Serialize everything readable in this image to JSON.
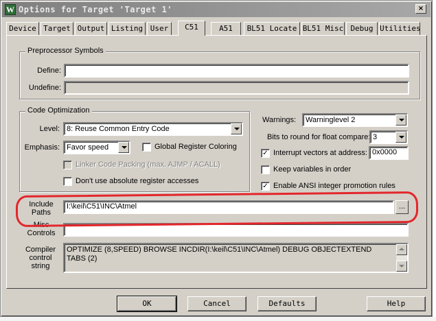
{
  "window": {
    "title": "Options for Target 'Target 1'",
    "app_icon_letter": "W",
    "close_glyph": "×"
  },
  "tabs": [
    {
      "label": "Device"
    },
    {
      "label": "Target"
    },
    {
      "label": "Output"
    },
    {
      "label": "Listing"
    },
    {
      "label": "User"
    },
    {
      "label": "C51",
      "active": true
    },
    {
      "label": "A51"
    },
    {
      "label": "BL51 Locate"
    },
    {
      "label": "BL51 Misc"
    },
    {
      "label": "Debug"
    },
    {
      "label": "Utilities"
    }
  ],
  "preprocessor": {
    "title": "Preprocessor Symbols",
    "define_label": "Define:",
    "define_value": "",
    "undefine_label": "Undefine:",
    "undefine_value": ""
  },
  "optimization": {
    "title": "Code Optimization",
    "level_label": "Level:",
    "level_value": "8: Reuse Common Entry Code",
    "emphasis_label": "Emphasis:",
    "emphasis_value": "Favor speed",
    "global_register_label": "Global Register Coloring",
    "global_register_checked": false,
    "linker_packing_label": "Linker Code Packing (max. AJMP / ACALL)",
    "linker_packing_checked": false,
    "no_absolute_label": "Don't use absolute register accesses",
    "no_absolute_checked": false
  },
  "options": {
    "warnings_label": "Warnings:",
    "warnings_value": "Warninglevel 2",
    "float_label": "Bits to round for float compare:",
    "float_value": "3",
    "interrupt_label": "Interrupt vectors at address:",
    "interrupt_checked": true,
    "interrupt_value": "0x0000",
    "keep_vars_label": "Keep variables in order",
    "keep_vars_checked": false,
    "ansi_label": "Enable ANSI integer promotion rules",
    "ansi_checked": true
  },
  "include": {
    "label_line1": "Include",
    "label_line2": "Paths",
    "value": "I:\\keil\\C51\\INC\\Atmel",
    "browse_label": "..."
  },
  "misc": {
    "label_line1": "Misc",
    "label_line2": "Controls",
    "value": ""
  },
  "compiler": {
    "label_line1": "Compiler",
    "label_line2": "control",
    "label_line3": "string",
    "value": "OPTIMIZE (8,SPEED) BROWSE INCDIR(I:\\keil\\C51\\INC\\Atmel) DEBUG OBJECTEXTEND TABS (2)"
  },
  "buttons": {
    "ok": "OK",
    "cancel": "Cancel",
    "defaults": "Defaults",
    "help": "Help"
  },
  "colors": {
    "dialog_bg": "#d4d0c8",
    "annotation": "#e3262b",
    "titlebar_inactive": "#808080"
  }
}
